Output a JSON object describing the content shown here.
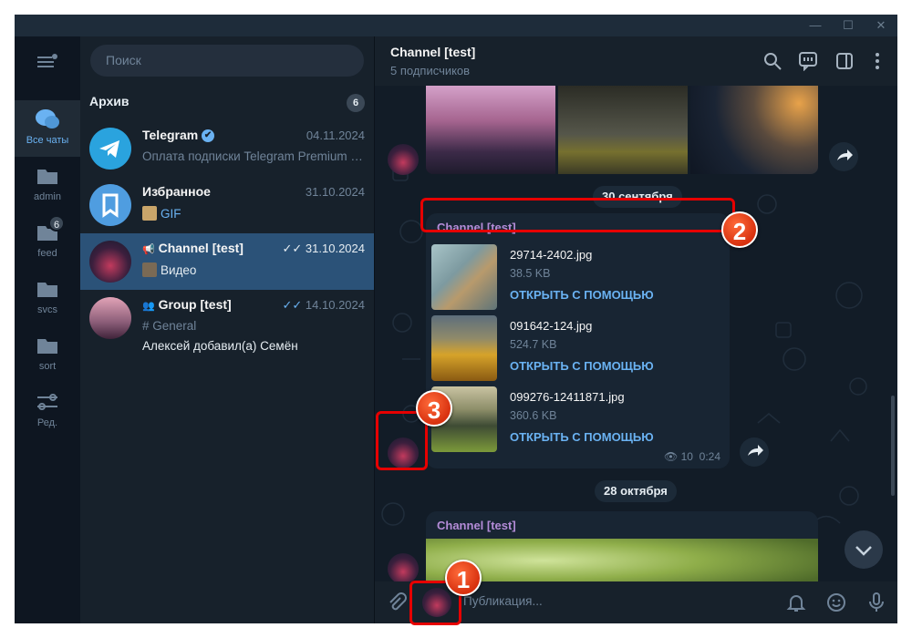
{
  "sidebar": {
    "folders": [
      {
        "label": "Все чаты",
        "icon": "chats-icon",
        "active": true
      },
      {
        "label": "admin",
        "icon": "folder-icon"
      },
      {
        "label": "feed",
        "icon": "folder-icon",
        "badge": "6"
      },
      {
        "label": "svcs",
        "icon": "folder-icon"
      },
      {
        "label": "sort",
        "icon": "folder-icon"
      },
      {
        "label": "Ред.",
        "icon": "sliders-icon"
      }
    ]
  },
  "search": {
    "placeholder": "Поиск"
  },
  "archive": {
    "label": "Архив",
    "count": "6"
  },
  "chats": [
    {
      "name": "Telegram",
      "date": "04.11.2024",
      "preview": "Оплата подписки Telegram Premium б...",
      "verified": true
    },
    {
      "name": "Избранное",
      "date": "31.10.2024",
      "preview": "GIF"
    },
    {
      "name": "Channel [test]",
      "date": "31.10.2024",
      "preview": "Видео",
      "active": true
    },
    {
      "name": "Group [test]",
      "date": "14.10.2024",
      "preview": "# General",
      "preview2": "Алексей добавил(а) Семён"
    }
  ],
  "header": {
    "title": "Channel [test]",
    "subtitle": "5 подписчиков"
  },
  "feed": {
    "date1": "30 сентября",
    "date2": "28 октября",
    "sender": "Channel [test]",
    "files": [
      {
        "name": "29714-2402.jpg",
        "size": "38.5 KB",
        "action": "ОТКРЫТЬ С ПОМОЩЬЮ"
      },
      {
        "name": "091642-124.jpg",
        "size": "524.7 KB",
        "action": "ОТКРЫТЬ С ПОМОЩЬЮ"
      },
      {
        "name": "099276-12411871.jpg",
        "size": "360.6 KB",
        "action": "ОТКРЫТЬ С ПОМОЩЬЮ"
      }
    ],
    "views": "10",
    "time": "0:24",
    "sender2": "Channel [test]"
  },
  "composer": {
    "placeholder": "Публикация..."
  },
  "markers": [
    "1",
    "2",
    "3"
  ],
  "colors": {
    "accent": "#6ab2f2",
    "active_chat": "#2b5278",
    "sender": "#b48cd8",
    "marker": "#e60000"
  }
}
